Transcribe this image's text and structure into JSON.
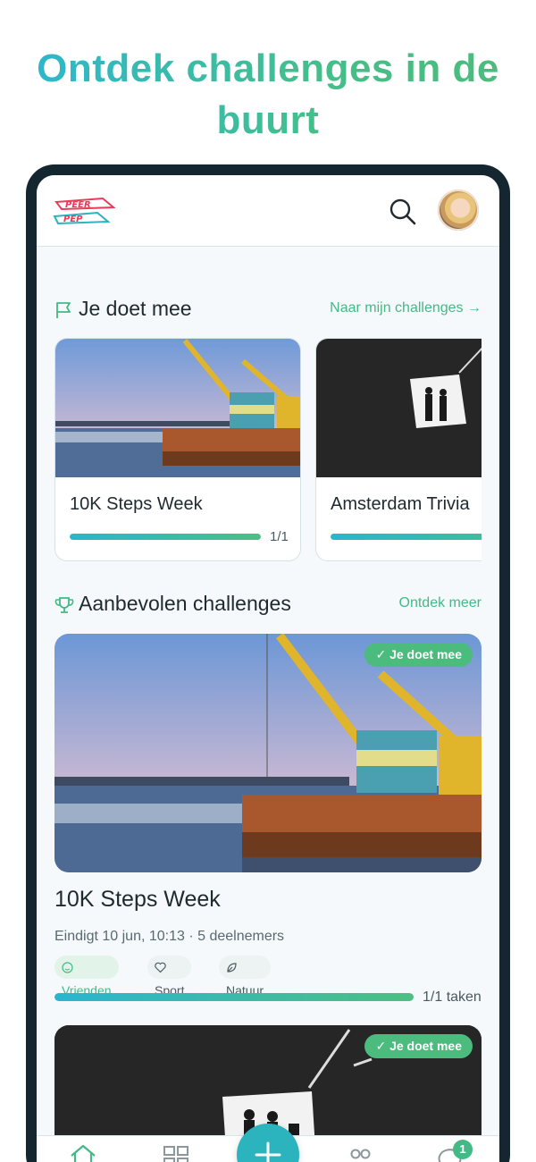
{
  "promo": {
    "title": "Ontdek challenges in de buurt"
  },
  "header": {
    "logo_text_top": "PEER",
    "logo_text_bottom": "PEP",
    "search_icon": "search-icon",
    "avatar_icon": "user-avatar"
  },
  "joined": {
    "title": "Je doet mee",
    "link": "Naar mijn challenges →",
    "icon": "flag-icon",
    "cards": [
      {
        "title": "10K Steps Week",
        "progress": 1.0,
        "count": "1/1"
      },
      {
        "title": "Amsterdam Trivia",
        "progress": 1.0,
        "count": ""
      }
    ]
  },
  "recommended": {
    "title": "Aanbevolen challenges",
    "link": "Ontdek meer",
    "icon": "trophy-icon",
    "items": [
      {
        "badge": "Je doet mee",
        "title": "10K Steps Week",
        "meta": "Eindigt 10 jun, 10:13 · 5 deelnemers",
        "tags": [
          "Vrienden",
          "Sport",
          "Natuur"
        ],
        "progress": 1.0,
        "progress_label": "1/1 taken"
      },
      {
        "badge": "Je doet mee"
      }
    ]
  },
  "bottom_nav": {
    "items": [
      "home-icon",
      "grid-icon",
      "add-icon",
      "people-icon",
      "chat-icon"
    ],
    "notification_count": "1"
  },
  "colors": {
    "accent_green": "#45b985",
    "accent_teal": "#2bb3be",
    "frame": "#14262f"
  }
}
